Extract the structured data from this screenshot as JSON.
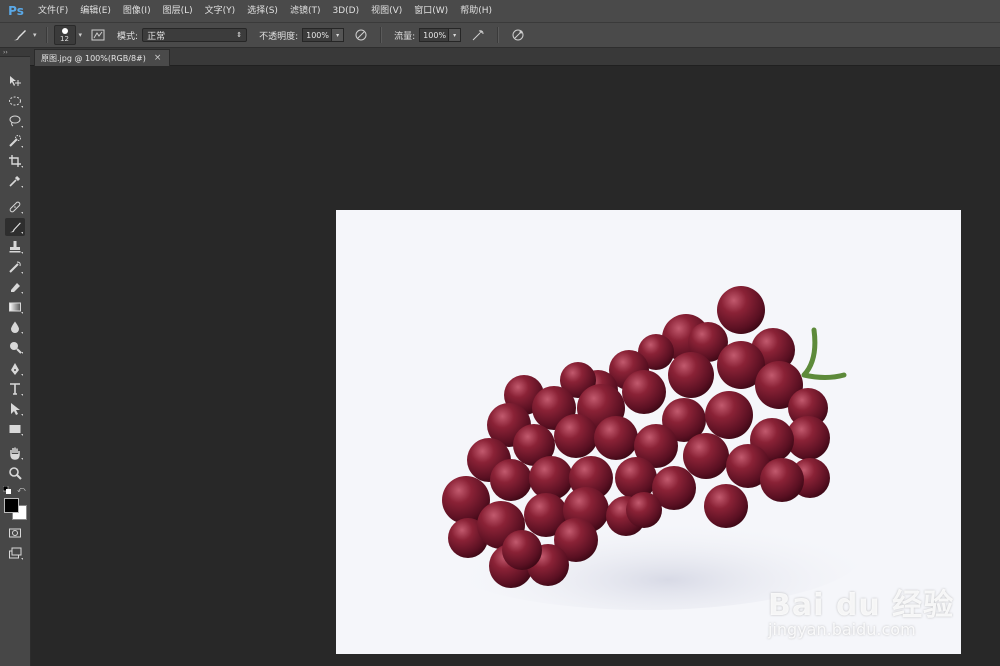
{
  "app": {
    "logo_text": "Ps"
  },
  "menu": [
    "文件(F)",
    "编辑(E)",
    "图像(I)",
    "图层(L)",
    "文字(Y)",
    "选择(S)",
    "滤镜(T)",
    "3D(D)",
    "视图(V)",
    "窗口(W)",
    "帮助(H)"
  ],
  "options": {
    "brush_size": "12",
    "mode_label": "模式:",
    "mode_value": "正常",
    "opacity_label": "不透明度:",
    "opacity_value": "100%",
    "flow_label": "流量:",
    "flow_value": "100%"
  },
  "document_tab": {
    "title": "原图.jpg @ 100%(RGB/8#)",
    "close": "×"
  },
  "toolbox": {
    "collapse": "››",
    "tools": [
      "move-tool",
      "marquee-tool",
      "lasso-tool",
      "quick-select-tool",
      "crop-tool",
      "eyedropper-tool",
      "healing-brush-tool",
      "brush-tool",
      "clone-stamp-tool",
      "history-brush-tool",
      "eraser-tool",
      "gradient-tool",
      "blur-tool",
      "dodge-tool",
      "pen-tool",
      "type-tool",
      "path-select-tool",
      "rectangle-tool",
      "hand-tool",
      "zoom-tool"
    ],
    "active_tool": "brush-tool",
    "foreground_color": "#000000",
    "background_color": "#ffffff"
  },
  "canvas_image": {
    "subject": "grapes",
    "watermark": "Bai du 经验",
    "watermark_url": "jingyan.baidu.com",
    "berry_color": "#6e1a2c",
    "stem_color": "#5d8a3a"
  }
}
